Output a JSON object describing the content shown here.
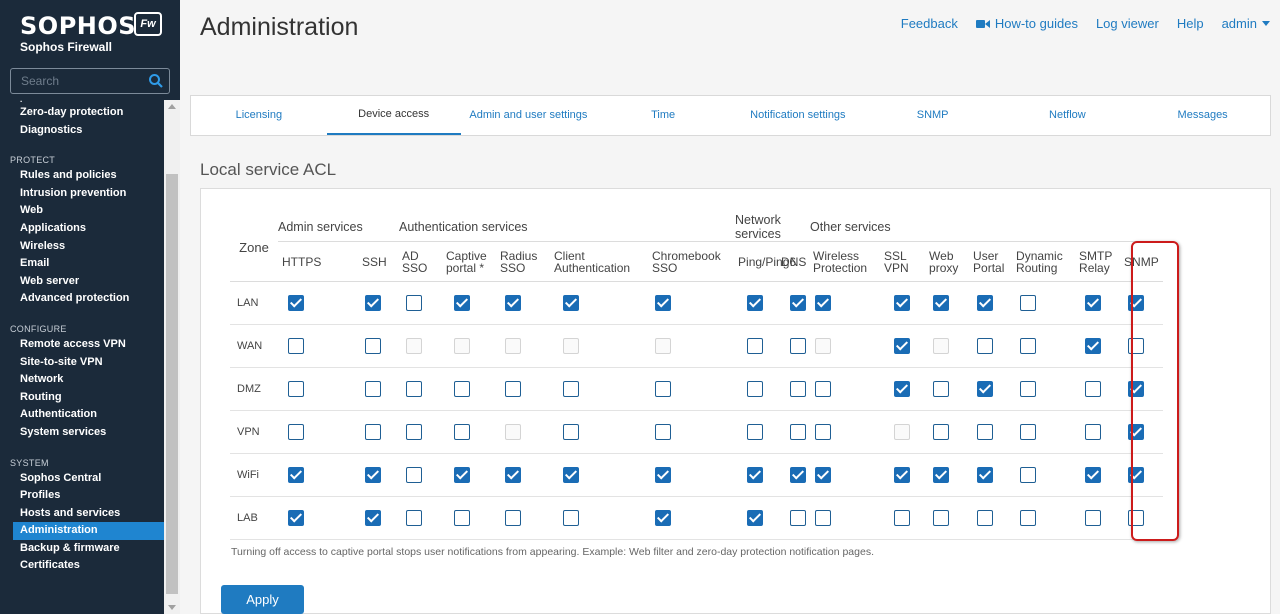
{
  "brand": {
    "name": "SOPHOS",
    "product": "Sophos Firewall",
    "badge": "Fw"
  },
  "search": {
    "placeholder": "Search"
  },
  "sidebar": {
    "partial_item": "·",
    "sections": [
      {
        "label": "",
        "items": [
          "Zero-day protection",
          "Diagnostics"
        ]
      },
      {
        "label": "PROTECT",
        "items": [
          "Rules and policies",
          "Intrusion prevention",
          "Web",
          "Applications",
          "Wireless",
          "Email",
          "Web server",
          "Advanced protection"
        ]
      },
      {
        "label": "CONFIGURE",
        "items": [
          "Remote access VPN",
          "Site-to-site VPN",
          "Network",
          "Routing",
          "Authentication",
          "System services"
        ]
      },
      {
        "label": "SYSTEM",
        "items": [
          "Sophos Central",
          "Profiles",
          "Hosts and services",
          "Administration",
          "Backup & firmware",
          "Certificates"
        ]
      }
    ],
    "active_item": "Administration"
  },
  "header": {
    "title": "Administration",
    "links": [
      "Feedback",
      "How-to guides",
      "Log viewer",
      "Help",
      "admin"
    ]
  },
  "tabs": [
    "Licensing",
    "Device access",
    "Admin and user settings",
    "Time",
    "Notification settings",
    "SNMP",
    "Netflow",
    "Messages"
  ],
  "active_tab": "Device access",
  "section_title": "Local service ACL",
  "acl": {
    "zone_header": "Zone",
    "groups": [
      {
        "label": "Admin services",
        "span": 2
      },
      {
        "label": "Authentication services",
        "span": 5
      },
      {
        "label": "Network services",
        "span": 2
      },
      {
        "label": "Other services",
        "span": 7
      }
    ],
    "columns": [
      "HTTPS",
      "SSH",
      "AD\nSSO",
      "Captive\nportal *",
      "Radius\nSSO",
      "Client\nAuthentication",
      "Chromebook\nSSO",
      "Ping/Ping6",
      "DNS",
      "Wireless\nProtection",
      "SSL\nVPN",
      "Web\nproxy",
      "User\nPortal",
      "Dynamic\nRouting",
      "SMTP\nRelay",
      "SNMP"
    ],
    "rows": [
      {
        "zone": "LAN",
        "values": [
          1,
          1,
          0,
          1,
          1,
          1,
          1,
          1,
          1,
          1,
          1,
          1,
          1,
          0,
          1,
          1
        ]
      },
      {
        "zone": "WAN",
        "values": [
          0,
          0,
          2,
          2,
          2,
          2,
          2,
          0,
          0,
          2,
          1,
          2,
          0,
          0,
          1,
          0
        ]
      },
      {
        "zone": "DMZ",
        "values": [
          0,
          0,
          0,
          0,
          0,
          0,
          0,
          0,
          0,
          0,
          1,
          0,
          1,
          0,
          0,
          1
        ]
      },
      {
        "zone": "VPN",
        "values": [
          0,
          0,
          0,
          0,
          2,
          0,
          0,
          0,
          0,
          0,
          2,
          0,
          0,
          0,
          0,
          1
        ]
      },
      {
        "zone": "WiFi",
        "values": [
          1,
          1,
          0,
          1,
          1,
          1,
          1,
          1,
          1,
          1,
          1,
          1,
          1,
          0,
          1,
          1
        ]
      },
      {
        "zone": "LAB",
        "values": [
          1,
          1,
          0,
          0,
          0,
          0,
          1,
          1,
          0,
          0,
          0,
          0,
          0,
          0,
          0,
          0
        ]
      }
    ],
    "value_legend": "0=unchecked, 1=checked, 2=disabled"
  },
  "note": "Turning off access to captive portal stops user notifications from appearing. Example: Web filter and zero-day protection notification pages.",
  "apply_label": "Apply",
  "colors": {
    "sidebar_bg": "#1b2a3a",
    "accent": "#1f7bc1",
    "highlight": "#cc1b1b"
  }
}
